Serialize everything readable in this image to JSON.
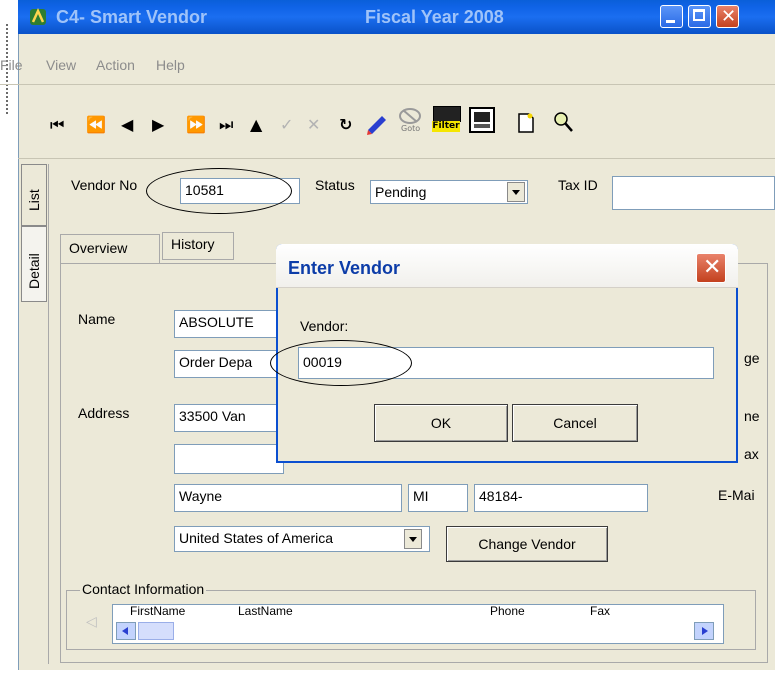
{
  "window": {
    "app_title": "C4- Smart Vendor",
    "fiscal_title": "Fiscal Year 2008"
  },
  "menu": [
    "File",
    "View",
    "Action",
    "Help"
  ],
  "toolbar_icons": [
    "first-record",
    "previous-page",
    "previous-record",
    "next-record",
    "next-page",
    "last-record",
    "up",
    "confirm",
    "cancel",
    "refresh",
    "edit",
    "goto",
    "filter",
    "report",
    "new-document",
    "search"
  ],
  "toolbar": {
    "goto_label": "Goto",
    "filter_label": "Filter"
  },
  "side_tabs": {
    "list": "List",
    "detail": "Detail"
  },
  "header": {
    "vendor_no_label": "Vendor No",
    "vendor_no_value": "10581",
    "status_label": "Status",
    "status_value": "Pending",
    "tax_id_label": "Tax ID",
    "tax_id_value": ""
  },
  "tabs": {
    "overview": "Overview",
    "history": "History"
  },
  "form": {
    "name_label": "Name",
    "name_value": "ABSOLUTE",
    "name2_value": "Order Depa",
    "address_label": "Address",
    "address1_value": "33500 Van",
    "address2_value": "",
    "city_value": "Wayne",
    "state_value": "MI",
    "zip_value": "48184-",
    "country_value": "United States of America",
    "change_vendor_label": "Change Vendor",
    "right_clipped_1": "ge",
    "right_clipped_2": "ne",
    "right_clipped_3": "ax",
    "email_label": "E-Mai"
  },
  "contact": {
    "legend": "Contact Information",
    "columns": [
      "FirstName",
      "LastName",
      "Phone",
      "Fax"
    ]
  },
  "dialog": {
    "title": "Enter Vendor",
    "vendor_label": "Vendor:",
    "vendor_value": "00019",
    "ok_label": "OK",
    "cancel_label": "Cancel"
  },
  "colors": {
    "titlebar": "#0a5fd9",
    "dialog_title_text": "#0c3ca8",
    "close_red": "#c3411e",
    "window_bg": "#ece9d8"
  }
}
